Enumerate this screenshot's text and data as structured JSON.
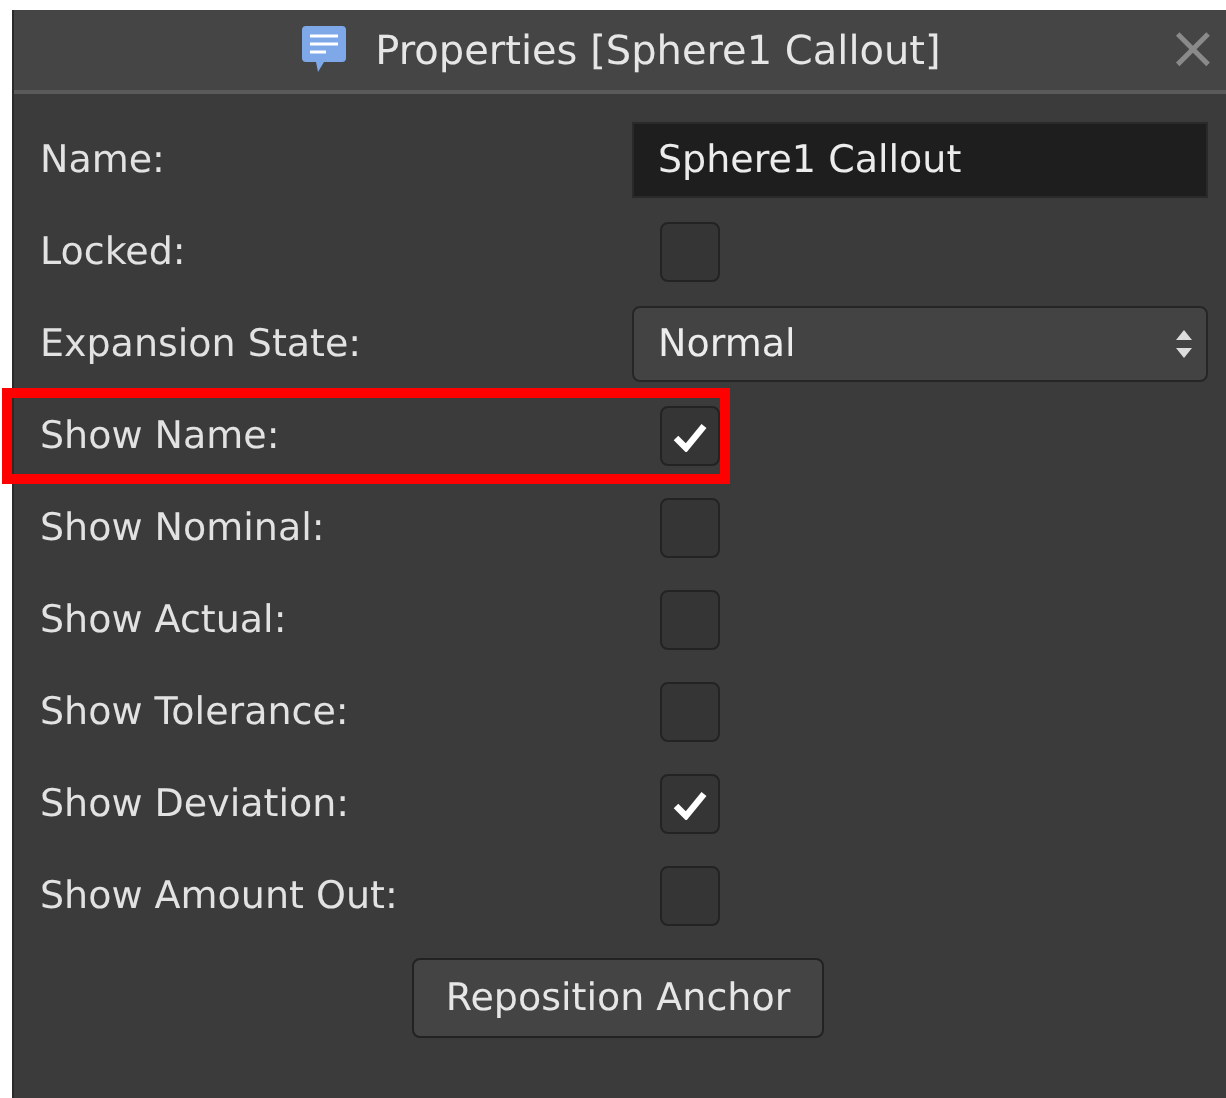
{
  "window": {
    "title": "Properties [Sphere1 Callout]",
    "close": "×"
  },
  "rows": [
    {
      "kind": "text",
      "label": "Name:",
      "value": "Sphere1 Callout",
      "highlighted": false
    },
    {
      "kind": "checkbox",
      "label": "Locked:",
      "checked": false,
      "highlighted": false
    },
    {
      "kind": "select",
      "label": "Expansion State:",
      "value": "Normal",
      "highlighted": false
    },
    {
      "kind": "checkbox",
      "label": "Show Name:",
      "checked": true,
      "highlighted": true
    },
    {
      "kind": "checkbox",
      "label": "Show Nominal:",
      "checked": false,
      "highlighted": false
    },
    {
      "kind": "checkbox",
      "label": "Show Actual:",
      "checked": false,
      "highlighted": false
    },
    {
      "kind": "checkbox",
      "label": "Show Tolerance:",
      "checked": false,
      "highlighted": false
    },
    {
      "kind": "checkbox",
      "label": "Show Deviation:",
      "checked": true,
      "highlighted": false
    },
    {
      "kind": "checkbox",
      "label": "Show Amount Out:",
      "checked": false,
      "highlighted": false
    }
  ],
  "button": "Reposition Anchor"
}
